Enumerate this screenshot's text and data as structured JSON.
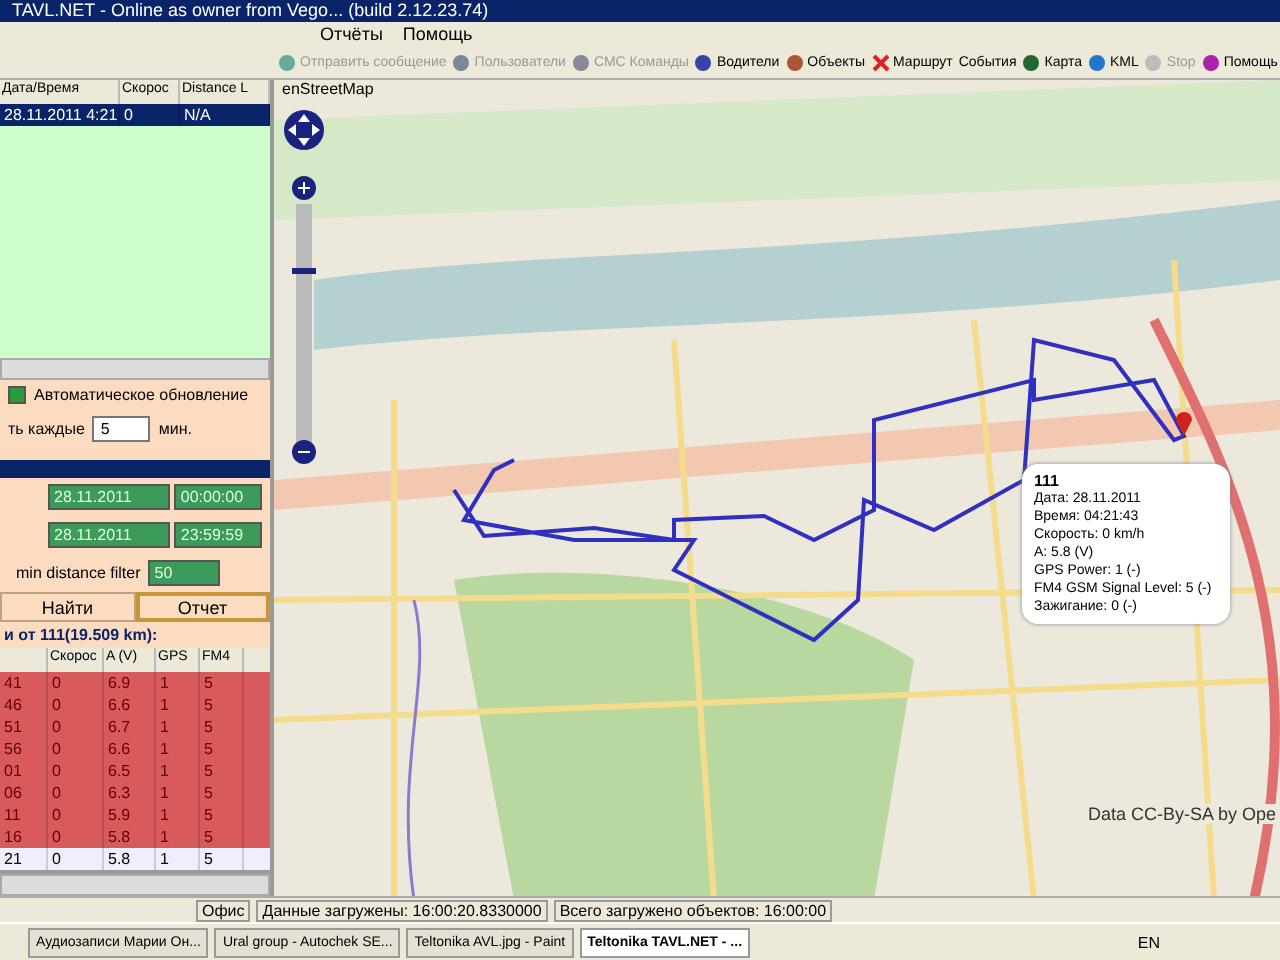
{
  "window": {
    "title": "TAVL.NET - Online as owner from Vego... (build 2.12.23.74)"
  },
  "menu": [
    "Отчёты",
    "Помощь"
  ],
  "toolbar": [
    {
      "label": "Отправить сообщение",
      "kind": "message",
      "disabled": true
    },
    {
      "label": "Пользователи",
      "kind": "users",
      "disabled": true
    },
    {
      "label": "СМС Команды",
      "kind": "sms",
      "disabled": true
    },
    {
      "label": "Водители",
      "kind": "drivers",
      "disabled": false
    },
    {
      "label": "Объекты",
      "kind": "objects",
      "disabled": false
    },
    {
      "label": "Маршрут",
      "kind": "route",
      "disabled": false
    },
    {
      "label": "События",
      "kind": "text",
      "disabled": false
    },
    {
      "label": "Карта",
      "kind": "map",
      "disabled": false
    },
    {
      "label": "KML",
      "kind": "kml",
      "disabled": false
    },
    {
      "label": "Stop",
      "kind": "stop",
      "disabled": true
    },
    {
      "label": "Помощь",
      "kind": "help",
      "disabled": false
    }
  ],
  "objects_table": {
    "columns": [
      "Дата/Время",
      "Скорос",
      "Distance L"
    ],
    "rows": [
      {
        "cells": [
          "28.11.2011 4:21",
          "0",
          "N/A"
        ],
        "selected": true
      }
    ]
  },
  "options": {
    "auto_update": {
      "label": "Автоматическое обновление",
      "checked": true
    },
    "interval_label": "ть каждые",
    "interval_value": "5",
    "interval_unit": "мин."
  },
  "report": {
    "date_from": "28.11.2011",
    "time_from": "00:00:00",
    "date_to": "28.11.2011",
    "time_to": "23:59:59",
    "distance_label": "min distance filter",
    "distance_value": "50",
    "buttons": [
      {
        "label": "Найти",
        "selected": false
      },
      {
        "label": "Отчет",
        "selected": true
      }
    ],
    "summary": "и от 111(19.509 km):"
  },
  "report_table": {
    "columns": [
      "",
      "Скорос",
      "A (V)",
      "GPS",
      "FM4"
    ],
    "rows": [
      {
        "cells": [
          "41",
          "0",
          "6.9",
          "1",
          "5"
        ],
        "alarm": true
      },
      {
        "cells": [
          "46",
          "0",
          "6.6",
          "1",
          "5"
        ],
        "alarm": true
      },
      {
        "cells": [
          "51",
          "0",
          "6.7",
          "1",
          "5"
        ],
        "alarm": true
      },
      {
        "cells": [
          "56",
          "0",
          "6.6",
          "1",
          "5"
        ],
        "alarm": true
      },
      {
        "cells": [
          "01",
          "0",
          "6.5",
          "1",
          "5"
        ],
        "alarm": true
      },
      {
        "cells": [
          "06",
          "0",
          "6.3",
          "1",
          "5"
        ],
        "alarm": true
      },
      {
        "cells": [
          "11",
          "0",
          "5.9",
          "1",
          "5"
        ],
        "alarm": true
      },
      {
        "cells": [
          "16",
          "0",
          "5.8",
          "1",
          "5"
        ],
        "alarm": true
      },
      {
        "cells": [
          "21",
          "0",
          "5.8",
          "1",
          "5"
        ],
        "alarm": false
      }
    ]
  },
  "map": {
    "layer": "enStreetMap",
    "popup": {
      "title": "111",
      "lines": [
        "Дата: 28.11.2011",
        "Время: 04:21:43",
        "Скорость: 0 km/h",
        "A: 5.8 (V)",
        "GPS Power: 1 (-)",
        "FM4 GSM Signal Level: 5 (-)",
        "Зажигание: 0 (-)"
      ]
    },
    "attribution": "Data CC-By-SA by Ope"
  },
  "status_bar": [
    "Офис",
    "Данные загружены: 16:00:20.8330000",
    "Всего загружено объектов: 16:00:00"
  ],
  "taskbar": {
    "tasks": [
      {
        "label": "Аудиозаписи Марии Он...",
        "selected": false
      },
      {
        "label": "Ural group - Autochek SE...",
        "selected": false
      },
      {
        "label": "Teltonika AVL.jpg - Paint",
        "selected": false
      },
      {
        "label": "Teltonika TAVL.NET - ...",
        "selected": true
      }
    ],
    "language": "EN"
  }
}
